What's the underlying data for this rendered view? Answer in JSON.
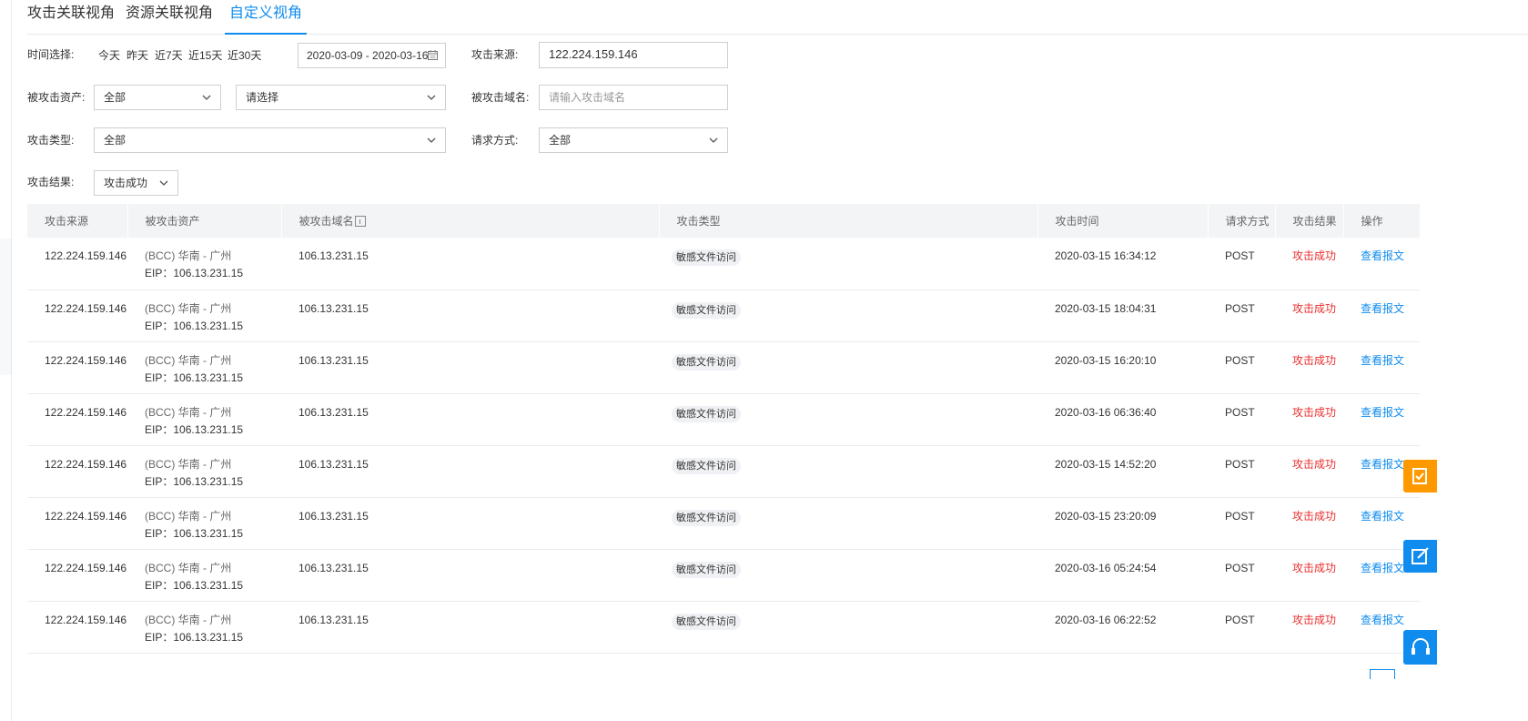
{
  "tabs": [
    "攻击关联视角",
    "资源关联视角",
    "自定义视角"
  ],
  "filters": {
    "time_label": "时间选择:",
    "quick_ranges": [
      "今天",
      "昨天",
      "近7天",
      "近15天",
      "近30天"
    ],
    "date_range": "2020-03-09 - 2020-03-16",
    "source_label": "攻击来源:",
    "source_value": "122.224.159.146",
    "asset_label": "被攻击资产:",
    "asset_value": "全部",
    "asset_detail_value": "请选择",
    "domain_label": "被攻击域名:",
    "domain_placeholder": "请输入攻击域名",
    "type_label": "攻击类型:",
    "type_value": "全部",
    "method_label": "请求方式:",
    "method_value": "全部",
    "result_label": "攻击结果:",
    "result_value": "攻击成功"
  },
  "table": {
    "headers": [
      "攻击来源",
      "被攻击资产",
      "被攻击域名",
      "攻击类型",
      "攻击时间",
      "请求方式",
      "攻击结果",
      "操作"
    ],
    "rows": [
      {
        "source": "122.224.159.146",
        "asset": "(BCC) 华南 - 广州",
        "eip": "EIP：106.13.231.15",
        "domain": "106.13.231.15",
        "type": "敏感文件访问",
        "time": "2020-03-15 16:34:12",
        "method": "POST",
        "result": "攻击成功",
        "action": "查看报文"
      },
      {
        "source": "122.224.159.146",
        "asset": "(BCC) 华南 - 广州",
        "eip": "EIP：106.13.231.15",
        "domain": "106.13.231.15",
        "type": "敏感文件访问",
        "time": "2020-03-15 18:04:31",
        "method": "POST",
        "result": "攻击成功",
        "action": "查看报文"
      },
      {
        "source": "122.224.159.146",
        "asset": "(BCC) 华南 - 广州",
        "eip": "EIP：106.13.231.15",
        "domain": "106.13.231.15",
        "type": "敏感文件访问",
        "time": "2020-03-15 16:20:10",
        "method": "POST",
        "result": "攻击成功",
        "action": "查看报文"
      },
      {
        "source": "122.224.159.146",
        "asset": "(BCC) 华南 - 广州",
        "eip": "EIP：106.13.231.15",
        "domain": "106.13.231.15",
        "type": "敏感文件访问",
        "time": "2020-03-16 06:36:40",
        "method": "POST",
        "result": "攻击成功",
        "action": "查看报文"
      },
      {
        "source": "122.224.159.146",
        "asset": "(BCC) 华南 - 广州",
        "eip": "EIP：106.13.231.15",
        "domain": "106.13.231.15",
        "type": "敏感文件访问",
        "time": "2020-03-15 14:52:20",
        "method": "POST",
        "result": "攻击成功",
        "action": "查看报文"
      },
      {
        "source": "122.224.159.146",
        "asset": "(BCC) 华南 - 广州",
        "eip": "EIP：106.13.231.15",
        "domain": "106.13.231.15",
        "type": "敏感文件访问",
        "time": "2020-03-15 23:20:09",
        "method": "POST",
        "result": "攻击成功",
        "action": "查看报文"
      },
      {
        "source": "122.224.159.146",
        "asset": "(BCC) 华南 - 广州",
        "eip": "EIP：106.13.231.15",
        "domain": "106.13.231.15",
        "type": "敏感文件访问",
        "time": "2020-03-16 05:24:54",
        "method": "POST",
        "result": "攻击成功",
        "action": "查看报文"
      },
      {
        "source": "122.224.159.146",
        "asset": "(BCC) 华南 - 广州",
        "eip": "EIP：106.13.231.15",
        "domain": "106.13.231.15",
        "type": "敏感文件访问",
        "time": "2020-03-16 06:22:52",
        "method": "POST",
        "result": "攻击成功",
        "action": "查看报文"
      }
    ]
  },
  "floating_buttons": [
    {
      "icon": "checklist-icon",
      "color": "#ff9900"
    },
    {
      "icon": "edit-icon",
      "color": "#108cee"
    },
    {
      "icon": "headset-icon",
      "color": "#108cee"
    }
  ],
  "colors": {
    "accent": "#108cee",
    "danger": "#ea2e2e",
    "header_bg": "#f3f4f6"
  }
}
